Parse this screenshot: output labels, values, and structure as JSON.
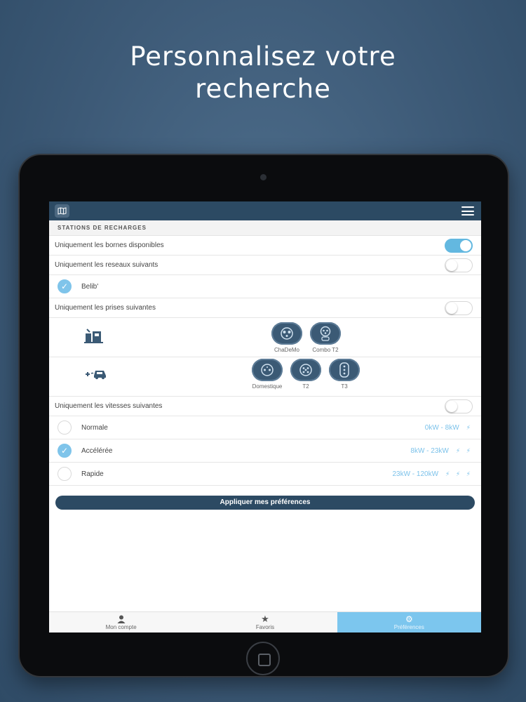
{
  "hero": {
    "line1": "Personnalisez votre",
    "line2": "recherche"
  },
  "topbar": {
    "map_icon": "map-icon",
    "menu_icon": "hamburger-menu-icon"
  },
  "section": {
    "title": "STATIONS DE RECHARGES"
  },
  "filters": {
    "available_only": {
      "label": "Uniquement les bornes disponibles",
      "on": true
    },
    "networks_only": {
      "label": "Uniquement les reseaux suivants",
      "on": false
    },
    "plugs_only": {
      "label": "Uniquement les prises suivantes",
      "on": false
    },
    "speeds_only": {
      "label": "Uniquement les vitesses suivantes",
      "on": false
    }
  },
  "networks": [
    {
      "label": "Belib'",
      "checked": true
    }
  ],
  "plugs": {
    "fast": {
      "icon": "charging-station-icon",
      "items": [
        "ChaDeMo",
        "Combo T2"
      ]
    },
    "standard": {
      "icon": "car-plug-icon",
      "items": [
        "Domestique",
        "T2",
        "T3"
      ]
    }
  },
  "speeds": [
    {
      "label": "Normale",
      "range": "0kW - 8kW",
      "bolts": "⚡",
      "checked": false
    },
    {
      "label": "Accélérée",
      "range": "8kW - 23kW",
      "bolts": "⚡ ⚡",
      "checked": true
    },
    {
      "label": "Rapide",
      "range": "23kW - 120kW",
      "bolts": "⚡ ⚡ ⚡",
      "checked": false
    }
  ],
  "apply_button": "Appliquer mes préférences",
  "tabs": [
    {
      "label": "Mon compte",
      "icon": "user-icon",
      "active": false
    },
    {
      "label": "Favoris",
      "icon": "star-icon",
      "active": false
    },
    {
      "label": "Préférences",
      "icon": "gear-icon",
      "active": true
    }
  ],
  "colors": {
    "accent": "#63b8e0",
    "navbar": "#2c4a63",
    "tab_active": "#7cc6ee"
  }
}
